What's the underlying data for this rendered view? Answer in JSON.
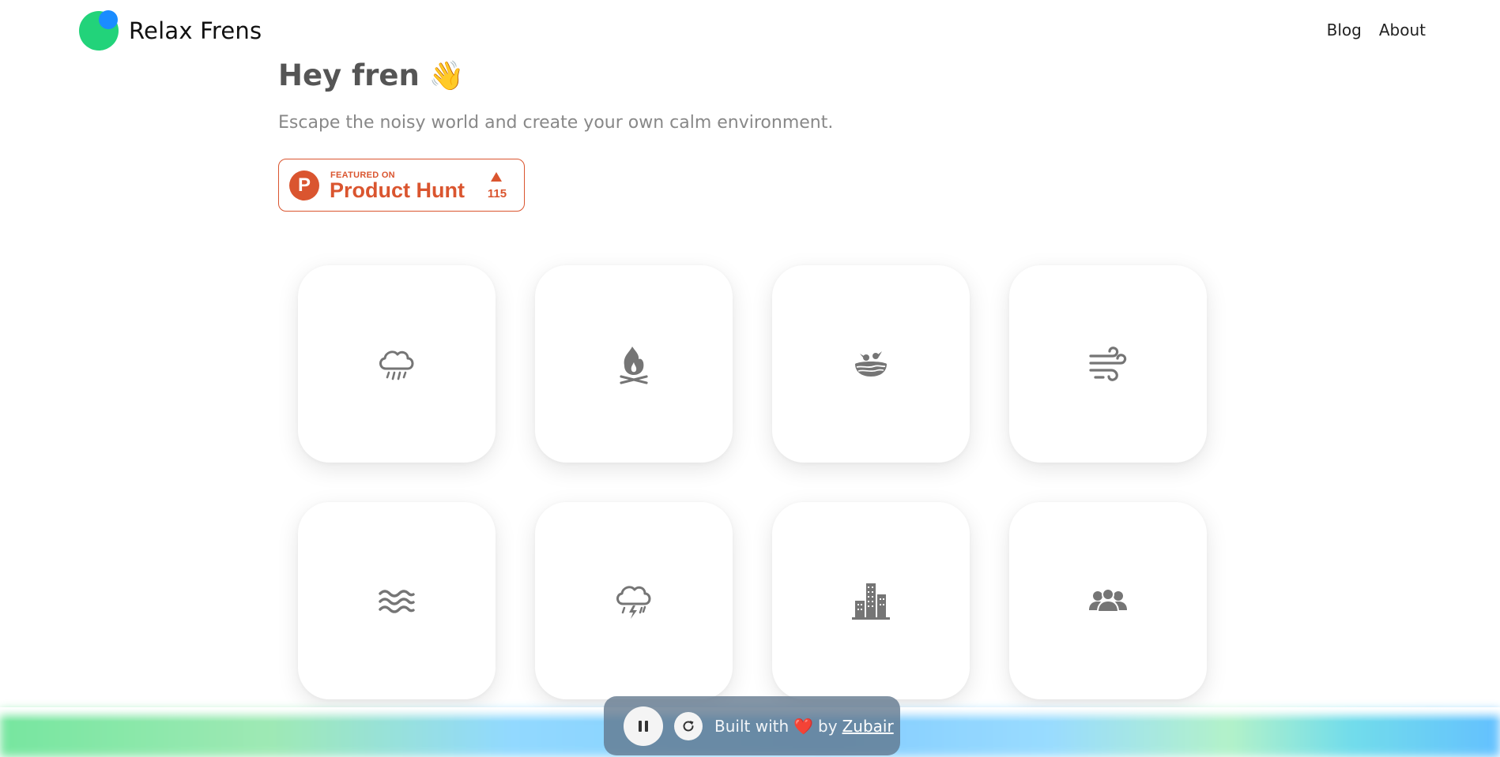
{
  "brand": {
    "name": "Relax Frens"
  },
  "nav": {
    "blog": "Blog",
    "about": "About"
  },
  "hero": {
    "title": "Hey fren",
    "emoji": "👋",
    "subtitle": "Escape the noisy world and create your own calm environment."
  },
  "product_hunt": {
    "featured_on": "FEATURED ON",
    "name": "Product Hunt",
    "logo_letter": "P",
    "upvotes": "115"
  },
  "sounds": [
    {
      "icon": "rain-cloud-icon"
    },
    {
      "icon": "campfire-icon"
    },
    {
      "icon": "bird-nest-icon"
    },
    {
      "icon": "wind-icon"
    },
    {
      "icon": "waves-icon"
    },
    {
      "icon": "thunderstorm-icon"
    },
    {
      "icon": "city-buildings-icon"
    },
    {
      "icon": "crowd-people-icon"
    }
  ],
  "footer": {
    "built_with": "Built with",
    "heart": "❤️",
    "by": "by",
    "author": "Zubair"
  },
  "colors": {
    "brand_green": "#22d37a",
    "brand_blue": "#1a8cff",
    "product_hunt": "#da552f",
    "icon_gray": "#757575"
  }
}
